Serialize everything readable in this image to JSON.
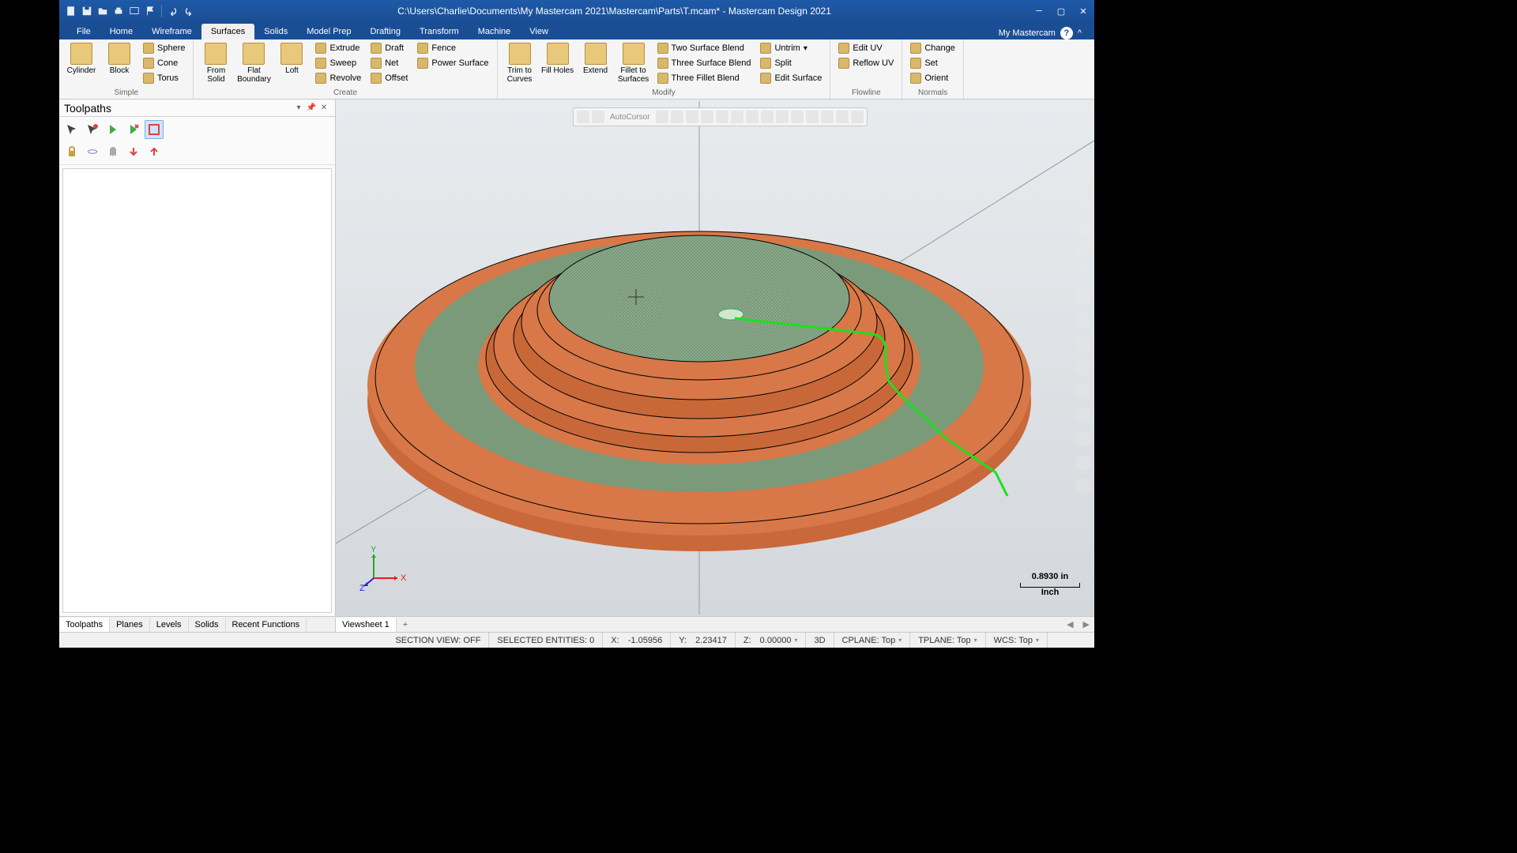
{
  "window": {
    "title": "C:\\Users\\Charlie\\Documents\\My Mastercam 2021\\Mastercam\\Parts\\T.mcam* - Mastercam Design 2021",
    "my_mastercam": "My Mastercam"
  },
  "tabs": {
    "items": [
      "File",
      "Home",
      "Wireframe",
      "Surfaces",
      "Solids",
      "Model Prep",
      "Drafting",
      "Transform",
      "Machine",
      "View"
    ],
    "active": "Surfaces"
  },
  "ribbon": {
    "groups": {
      "simple": {
        "label": "Simple",
        "big": [
          {
            "label": "Cylinder"
          },
          {
            "label": "Block"
          }
        ],
        "small": [
          {
            "label": "Sphere"
          },
          {
            "label": "Cone"
          },
          {
            "label": "Torus"
          }
        ]
      },
      "create": {
        "label": "Create",
        "big": [
          {
            "label": "From Solid"
          },
          {
            "label": "Flat Boundary"
          },
          {
            "label": "Loft"
          }
        ],
        "small": [
          {
            "label": "Extrude"
          },
          {
            "label": "Sweep"
          },
          {
            "label": "Revolve"
          },
          {
            "label": "Draft"
          },
          {
            "label": "Net"
          },
          {
            "label": "Offset"
          },
          {
            "label": "Fence"
          },
          {
            "label": "Power Surface"
          }
        ]
      },
      "modify": {
        "label": "Modify",
        "big": [
          {
            "label": "Trim to Curves"
          },
          {
            "label": "Fill Holes"
          },
          {
            "label": "Extend"
          },
          {
            "label": "Fillet to Surfaces"
          }
        ],
        "small": [
          {
            "label": "Two Surface Blend"
          },
          {
            "label": "Three Surface Blend"
          },
          {
            "label": "Three Fillet Blend"
          },
          {
            "label": "Untrim"
          },
          {
            "label": "Split"
          },
          {
            "label": "Edit Surface"
          }
        ]
      },
      "flowline": {
        "label": "Flowline",
        "small": [
          {
            "label": "Edit UV"
          },
          {
            "label": "Reflow UV"
          }
        ]
      },
      "normals": {
        "label": "Normals",
        "small": [
          {
            "label": "Change"
          },
          {
            "label": "Set"
          },
          {
            "label": "Orient"
          }
        ]
      }
    }
  },
  "panel": {
    "title": "Toolpaths",
    "tabs": [
      "Toolpaths",
      "Planes",
      "Levels",
      "Solids",
      "Recent Functions"
    ],
    "active_tab": "Toolpaths"
  },
  "viewport": {
    "autocursor": "AutoCursor",
    "sheet": "Viewsheet 1",
    "scale_value": "0.8930 in",
    "scale_unit": "Inch"
  },
  "status": {
    "section_view": "SECTION VIEW: OFF",
    "selected": "SELECTED ENTITIES: 0",
    "x_label": "X:",
    "x_value": "-1.05956",
    "y_label": "Y:",
    "y_value": "2.23417",
    "z_label": "Z:",
    "z_value": "0.00000",
    "mode": "3D",
    "cplane": "CPLANE: Top",
    "tplane": "TPLANE: Top",
    "wcs": "WCS: Top"
  }
}
